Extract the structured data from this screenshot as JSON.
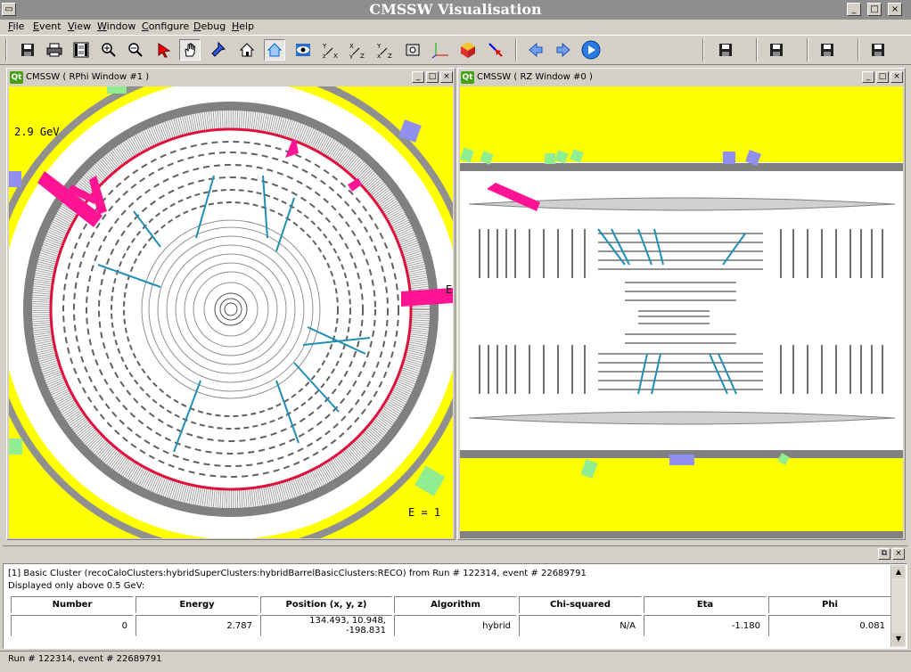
{
  "app": {
    "title": "CMSSW Visualisation"
  },
  "menu": [
    {
      "label": "File",
      "underline": "F",
      "rest": "ile"
    },
    {
      "label": "Event",
      "underline": "E",
      "rest": "vent"
    },
    {
      "label": "View",
      "underline": "V",
      "rest": "iew"
    },
    {
      "label": "Window",
      "underline": "W",
      "rest": "indow"
    },
    {
      "label": "Configure",
      "underline": "C",
      "rest": "onfigure"
    },
    {
      "label": "Debug",
      "underline": "D",
      "rest": "ebug"
    },
    {
      "label": "Help",
      "underline": "H",
      "rest": "elp"
    }
  ],
  "toolbar": {
    "icons": [
      "save-icon",
      "print-icon",
      "film-icon",
      "zoom-in-icon",
      "zoom-out-icon",
      "pick-arrow-icon",
      "hand-icon",
      "flashlight-icon",
      "home-icon",
      "set-home-icon",
      "eye-icon",
      "xy-axes-icon",
      "yz-axes-icon",
      "xz-axes-icon",
      "snapshot-icon",
      "axes-icon",
      "cube-icon",
      "pointer-icon",
      "back-arrow-icon",
      "forward-arrow-icon",
      "play-icon"
    ],
    "more": "»"
  },
  "rphi": {
    "title": "CMSSW ( RPhi Window #1 )",
    "qt": "Qt",
    "scale_label": "2.9 GeV",
    "energy_label": "E = 1",
    "edge_label": "E"
  },
  "rz": {
    "title": "CMSSW ( RZ Window #0 )",
    "qt": "Qt"
  },
  "info": {
    "header": "[1] Basic Cluster (recoCaloClusters:hybridSuperClusters:hybridBarrelBasicClusters:RECO) from Run # 122314, event # 22689791",
    "subheader": "Displayed only above 0.5 GeV:",
    "columns": [
      "Number",
      "Energy",
      "Position (x, y, z)",
      "Algorithm",
      "Chi-squared",
      "Eta",
      "Phi"
    ],
    "row": [
      "0",
      "2.787",
      "134.493, 10.948, -198.831",
      "hybrid",
      "N/A",
      "-1.180",
      "0.081"
    ]
  },
  "status": {
    "text": "Run # 122314, event # 22689791"
  },
  "colors": {
    "yellow": "#ffff00",
    "magenta": "#ff1493",
    "track": "#1f8fb3",
    "gray": "#808080"
  }
}
